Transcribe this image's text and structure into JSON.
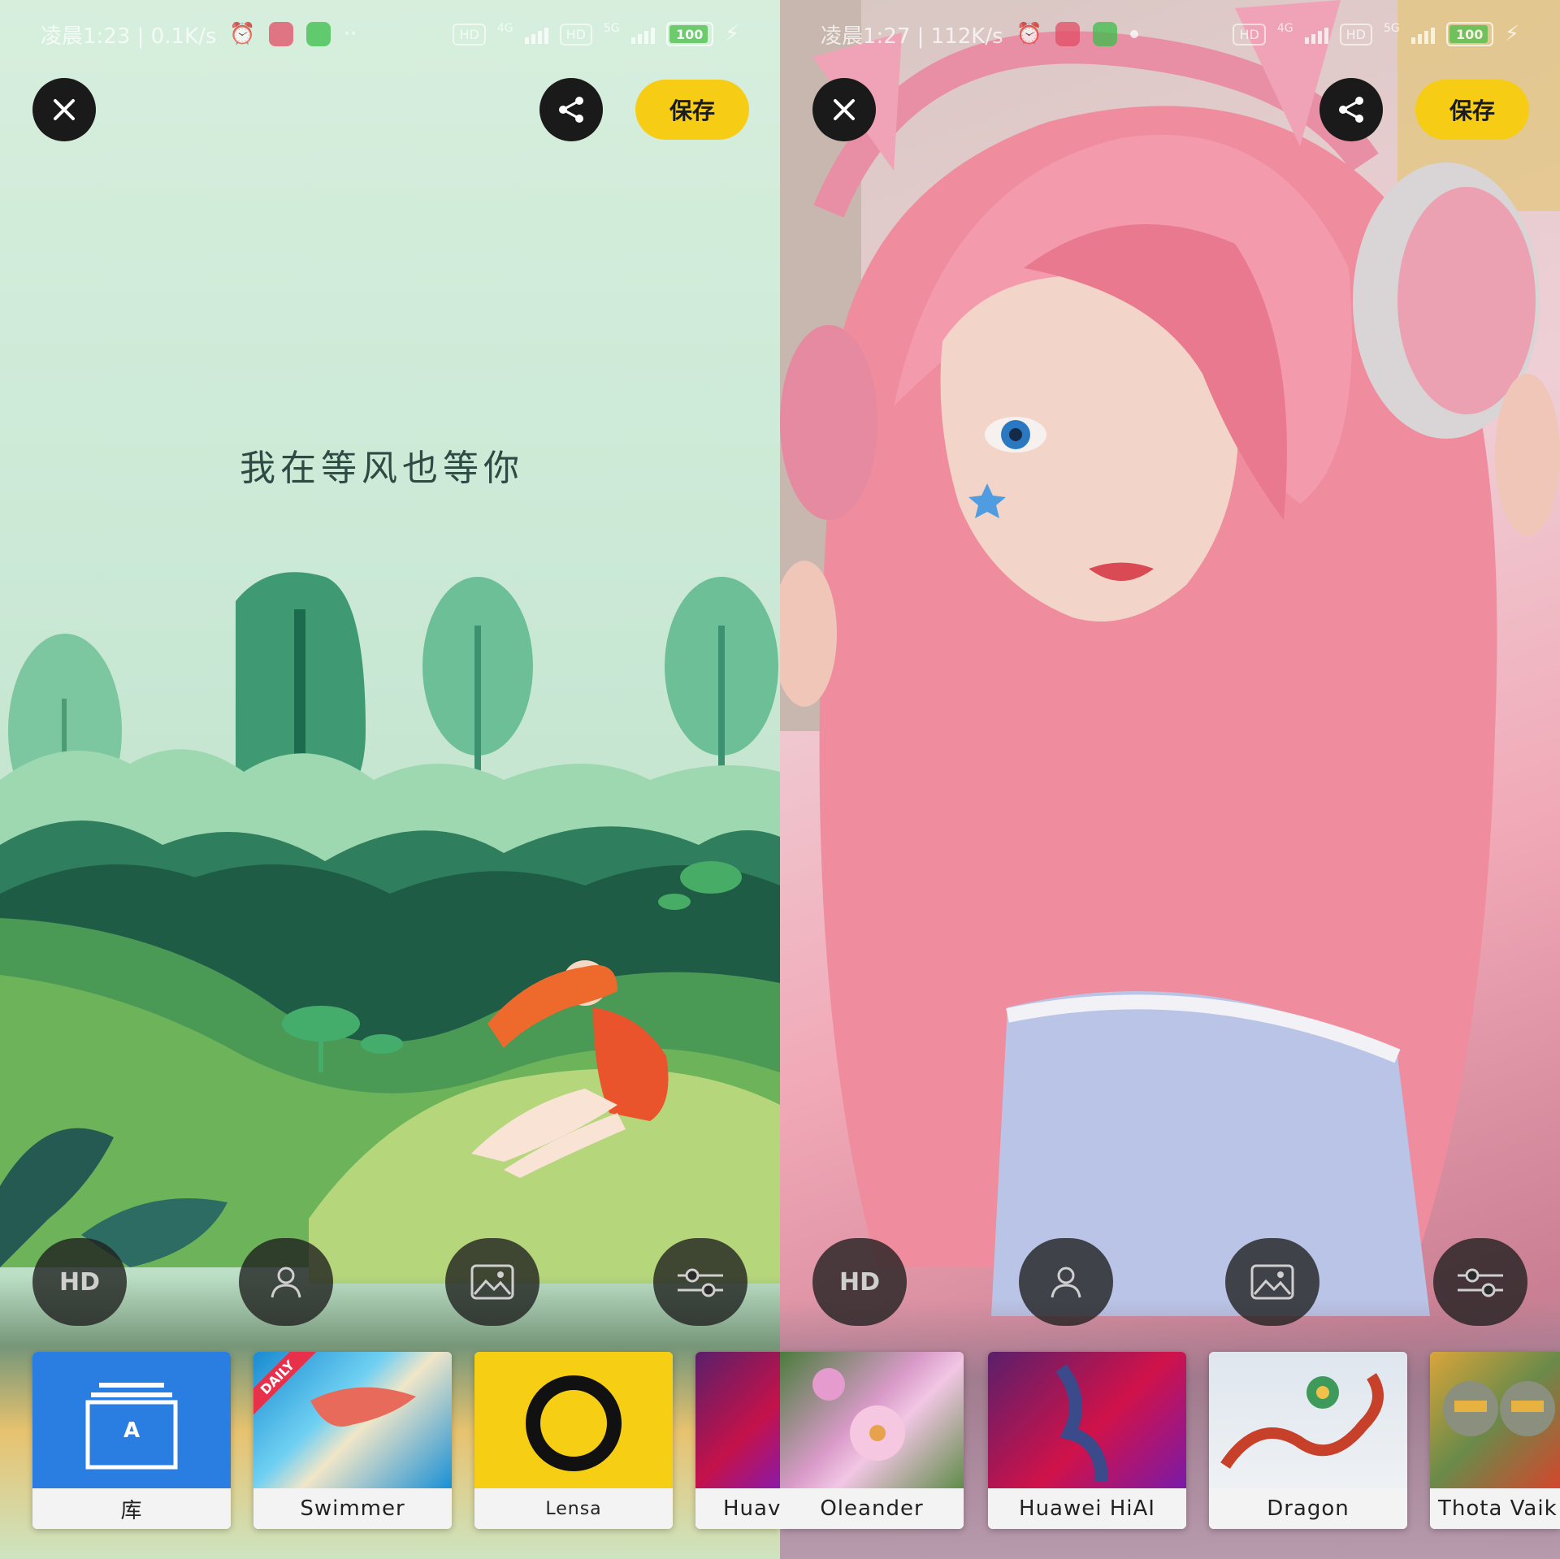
{
  "left": {
    "status": {
      "time": "凌晨1:23 | 0.1K/s",
      "battery": "100",
      "net1": "HD",
      "net1_gen": "4G",
      "net2": "HD",
      "net2_gen": "5G"
    },
    "buttons": {
      "save_label": "保存",
      "hd_label": "HD"
    },
    "quote": "我在等风也等你",
    "cards": [
      {
        "label": "库",
        "thumb_label": "A"
      },
      {
        "label": "Swimmer",
        "badge": "DAILY"
      },
      {
        "label": "Lensa"
      },
      {
        "label": "Huav"
      }
    ]
  },
  "right": {
    "status": {
      "time": "凌晨1:27 | 112K/s",
      "battery": "100",
      "net1": "HD",
      "net1_gen": "4G",
      "net2": "HD",
      "net2_gen": "5G"
    },
    "buttons": {
      "save_label": "保存",
      "hd_label": "HD"
    },
    "cards": [
      {
        "label": "Oleander"
      },
      {
        "label": "Huawei HiAI"
      },
      {
        "label": "Dragon"
      },
      {
        "label": "Thota Vaik"
      }
    ]
  },
  "colors": {
    "save_button": "#f6cd14",
    "library_card": "#2a7de1",
    "lensa_card": "#f6cf14"
  }
}
